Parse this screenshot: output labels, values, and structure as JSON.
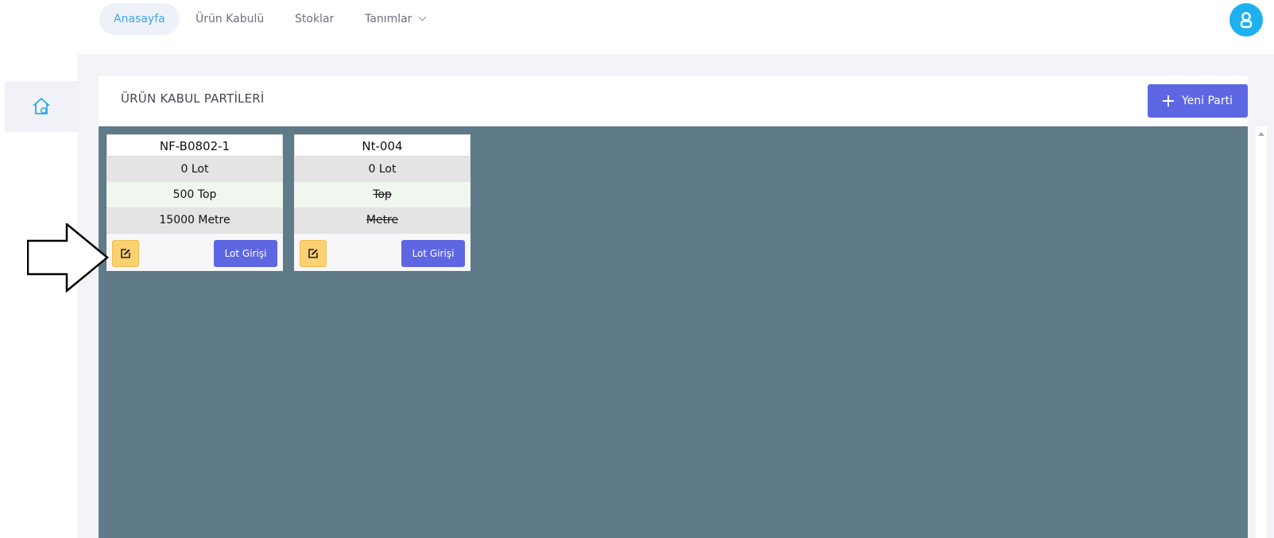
{
  "nav": {
    "tabs": [
      {
        "label": "Anasayfa",
        "active": true
      },
      {
        "label": "Ürün Kabulü",
        "active": false
      },
      {
        "label": "Stoklar",
        "active": false
      },
      {
        "label": "Tanımlar",
        "active": false,
        "has_dropdown": true
      }
    ],
    "avatar_icon": "user-icon"
  },
  "sidebar": {
    "items": [
      {
        "icon": "home-icon",
        "active": true
      }
    ]
  },
  "main": {
    "title": "ÜRÜN KABUL PARTİLERİ",
    "new_button_label": "Yeni Parti",
    "cards": [
      {
        "name": "NF-B0802-1",
        "lot": "0 Lot",
        "top": "500 Top",
        "metre": "15000 Metre",
        "top_struck": false,
        "metre_struck": false,
        "lot_button": "Lot Girişi"
      },
      {
        "name": "Nt-004",
        "lot": "0 Lot",
        "top": "Top",
        "metre": "Metre",
        "top_struck": true,
        "metre_struck": true,
        "lot_button": "Lot Girişi"
      }
    ]
  },
  "colors": {
    "accent": "#5e67e2",
    "active_tab_text": "#3aa6e5",
    "avatar": "#1fb0ef",
    "board": "#5f7b89",
    "edit_button": "#fcd171"
  },
  "annotation": {
    "icon": "right-arrow-outline-icon"
  }
}
